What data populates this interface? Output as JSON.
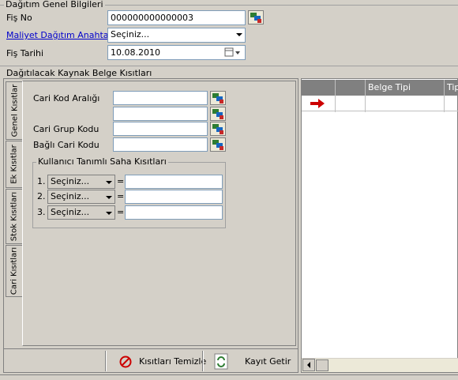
{
  "header": {
    "section_title": "Dağıtım Genel Bilgileri",
    "fis_no_label": "Fiş No",
    "fis_no_value": "000000000000003",
    "anahtar_label": "Maliyet Dağıtım Anahtarı",
    "anahtar_value": "Seçiniz...",
    "fis_tarihi_label": "Fiş Tarihi",
    "fis_tarihi_value": "10.08.2010"
  },
  "panel": {
    "title": "Dağıtılacak Kaynak Belge Kısıtları",
    "tabs": [
      "Genel Kısıtlar",
      "Ek Kısıtlar",
      "Stok Kısıtları",
      "Cari Kısıtları"
    ],
    "active_tab": "Genel Kısıtlar",
    "cari_kod_araligi_label": "Cari Kod Aralığı",
    "cari_kod_from": "",
    "cari_kod_to": "",
    "cari_grup_kodu_label": "Cari Grup Kodu",
    "cari_grup_kodu_value": "",
    "bagli_cari_kodu_label": "Bağlı Cari Kodu",
    "bagli_cari_kodu_value": "",
    "user_group_title": "Kullanıcı Tanımlı Saha Kısıtları",
    "user_rows": [
      {
        "num": "1.",
        "select": "Seçiniz...",
        "eq": "=",
        "value": ""
      },
      {
        "num": "2.",
        "select": "Seçiniz...",
        "eq": "=",
        "value": ""
      },
      {
        "num": "3.",
        "select": "Seçiniz...",
        "eq": "=",
        "value": ""
      }
    ]
  },
  "buttons": {
    "clear_label": "Kısıtları Temizle",
    "fetch_label": "Kayıt Getir"
  },
  "grid": {
    "columns": [
      "",
      "",
      "Belge Tipi",
      "Tip"
    ]
  },
  "colors": {
    "window_bg": "#d4d0c8",
    "grid_header_bg": "#808080",
    "link_color": "#0000cc",
    "arrow_red": "#cc0000"
  }
}
